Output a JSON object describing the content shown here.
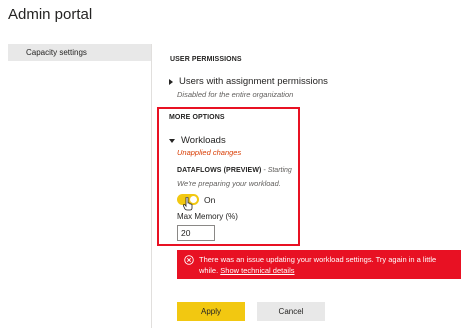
{
  "app": {
    "title": "Admin portal"
  },
  "sidebar": {
    "items": [
      {
        "label": "Capacity settings"
      }
    ]
  },
  "user_permissions": {
    "heading": "USER PERMISSIONS",
    "users_label": "Users with assignment permissions",
    "users_subtext": "Disabled for the entire organization"
  },
  "more_options": {
    "heading": "MORE OPTIONS",
    "workloads_label": "Workloads",
    "unapplied_text": "Unapplied changes",
    "dataflows_name": "DATAFLOWS (PREVIEW)",
    "dataflows_status": " - Starting",
    "preparing_text": "We're preparing your workload.",
    "toggle_label": "On",
    "toggle_on": true,
    "max_memory_label": "Max Memory (%)",
    "max_memory_value": "20"
  },
  "error": {
    "message": "There was an issue updating your workload settings. Try again in a little while.",
    "link_text": "Show technical details"
  },
  "buttons": {
    "apply": "Apply",
    "cancel": "Cancel"
  },
  "colors": {
    "accent": "#f2c811",
    "error": "#e81123",
    "highlight_border": "#e81123",
    "warning_text": "#d83b01"
  },
  "icons": {
    "error": "error-circle-icon",
    "cursor": "hand-pointer-icon"
  }
}
